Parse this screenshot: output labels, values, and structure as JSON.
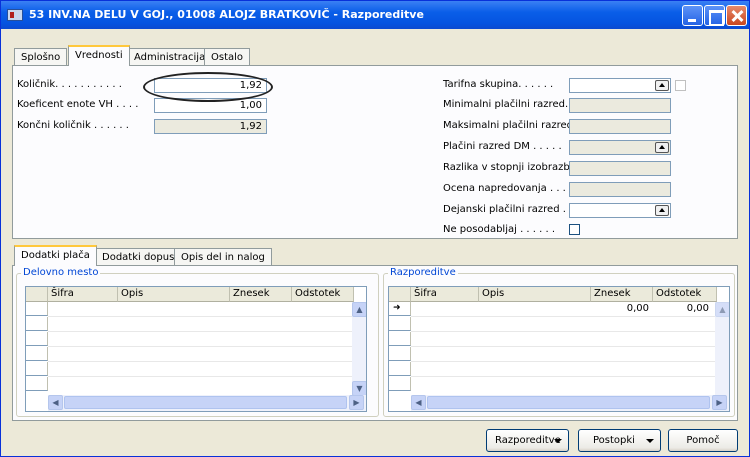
{
  "window": {
    "title": "53 INV.NA DELU V GOJ., 01008 ALOJZ BRATKOVIČ - Razporeditve"
  },
  "top_tabs": [
    {
      "label": "Splošno"
    },
    {
      "label": "Vrednosti"
    },
    {
      "label": "Administracija"
    },
    {
      "label": "Ostalo"
    }
  ],
  "left_fields": {
    "kolicnik_label": "Količnik. . . . . . . . . . .",
    "kolicnik_value": "1,92",
    "koeficient_label": "Koeficent enote VH . . . .",
    "koeficient_value": "1,00",
    "koncni_label": "Končni količnik . . . . . .",
    "koncni_value": "1,92"
  },
  "right_fields": {
    "tarifna_label": "Tarifna skupina. . . . . .",
    "tarifna_value": "",
    "min_razred_label": "Minimalni plačilni razred. .",
    "min_razred_value": "",
    "max_razred_label": "Maksimalni plačilni razred .",
    "max_razred_value": "",
    "dm_label": "Plačini razred DM . . . . .",
    "dm_value": "",
    "razlika_label": "Razlika v stopnji izobrazbe",
    "razlika_value": "",
    "ocena_label": "Ocena napredovanja . . .",
    "ocena_value": "",
    "dejanski_label": "Dejanski plačilni razred . .",
    "dejanski_value": "",
    "ne_posodabljaj_label": "Ne posodabljaj . . . . . .",
    "ne_posodabljaj_checked": false
  },
  "bottom_tabs": [
    {
      "label": "Dodatki plača"
    },
    {
      "label": "Dodatki dopust"
    },
    {
      "label": "Opis del in nalog"
    }
  ],
  "left_grid": {
    "group_title": "Delovno mesto",
    "columns": [
      "Šifra",
      "Opis",
      "Znesek",
      "Odstotek"
    ]
  },
  "right_grid": {
    "group_title": "Razporeditve",
    "columns": [
      "Šifra",
      "Opis",
      "Znesek",
      "Odstotek"
    ],
    "rows": [
      {
        "sifra": "",
        "opis": "",
        "znesek": "0,00",
        "odstotek": "0,00"
      }
    ]
  },
  "buttons": {
    "razporeditve": "Razporeditve",
    "postopki": "Postopki",
    "pomoc": "Pomoč"
  },
  "colors": {
    "titlebar": "#0553e0",
    "group_title": "#0046d5",
    "active_tab_accent": "#ffc83c"
  }
}
